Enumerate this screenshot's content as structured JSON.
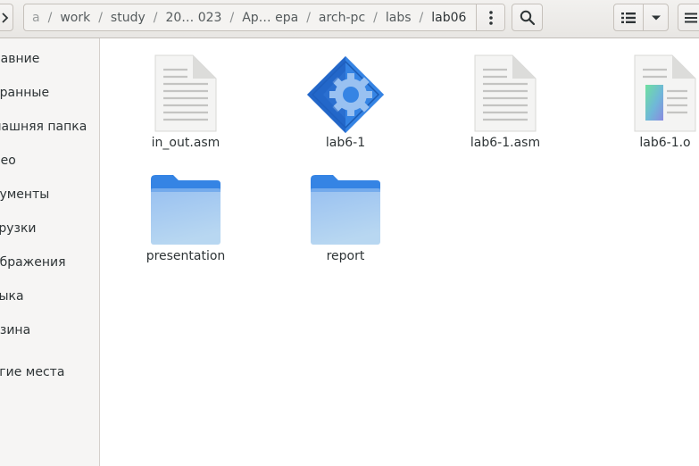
{
  "toolbar": {
    "path": [
      {
        "label": "a",
        "kind": "first"
      },
      {
        "label": "work"
      },
      {
        "label": "study"
      },
      {
        "label": "20… 023"
      },
      {
        "label": "Ар… ера"
      },
      {
        "label": "arch-pc"
      },
      {
        "label": "labs"
      },
      {
        "label": "lab06",
        "kind": "current"
      }
    ],
    "separator": "/"
  },
  "sidebar": {
    "items": [
      {
        "label": "давние"
      },
      {
        "label": "бранные"
      },
      {
        "label": "машняя папка"
      },
      {
        "label": "део"
      },
      {
        "label": "кументы"
      },
      {
        "label": "грузки"
      },
      {
        "label": "ображения"
      },
      {
        "label": "зыка"
      },
      {
        "label": "рзина"
      },
      {
        "label": "угие места"
      }
    ]
  },
  "files": [
    {
      "name": "in_out.asm",
      "icon": "text-file-icon"
    },
    {
      "name": "lab6-1",
      "icon": "executable-icon"
    },
    {
      "name": "lab6-1.asm",
      "icon": "text-file-icon"
    },
    {
      "name": "lab6-1.o",
      "icon": "object-file-icon"
    },
    {
      "name": "presentation",
      "icon": "folder-icon"
    },
    {
      "name": "report",
      "icon": "folder-icon"
    }
  ],
  "colors": {
    "folder_top": "#3584e4",
    "folder_body": "#a6c9ee",
    "executable": "#2a6fd0"
  }
}
